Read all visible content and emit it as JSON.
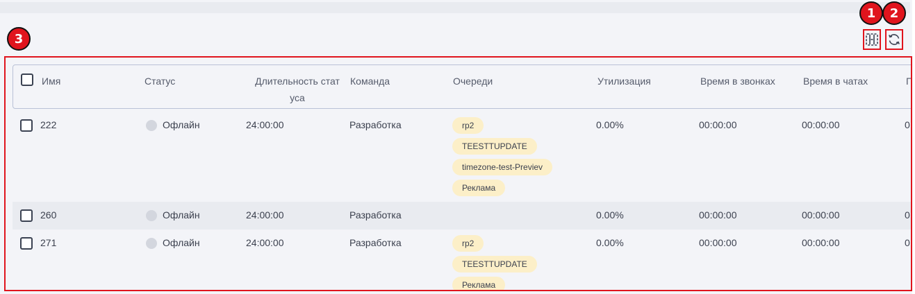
{
  "markers": [
    "1",
    "2",
    "3"
  ],
  "toolbar": {
    "columns_icon": "table-columns-icon",
    "refresh_icon": "refresh-icon"
  },
  "table": {
    "headers": {
      "name": "Имя",
      "status": "Статус",
      "duration_line1": "Длительность стат",
      "duration_line2": "уса",
      "team": "Команда",
      "queues": "Очереди",
      "utilization": "Утилизация",
      "call_time": "Время в звонках",
      "chat_time": "Время в чатах",
      "next_partial": "П"
    },
    "rows": [
      {
        "name": "222",
        "status": "Офлайн",
        "duration": "24:00:00",
        "team": "Разработка",
        "queues": [
          "rp2",
          "TEESTTUPDATE",
          "timezone-test-Previev",
          "Реклама"
        ],
        "utilization": "0.00%",
        "call_time": "00:00:00",
        "chat_time": "00:00:00",
        "next_partial": "0"
      },
      {
        "name": "260",
        "status": "Офлайн",
        "duration": "24:00:00",
        "team": "Разработка",
        "queues": [],
        "utilization": "0.00%",
        "call_time": "00:00:00",
        "chat_time": "00:00:00",
        "next_partial": "0"
      },
      {
        "name": "271",
        "status": "Офлайн",
        "duration": "24:00:00",
        "team": "Разработка",
        "queues": [
          "rp2",
          "TEESTTUPDATE",
          "Реклама"
        ],
        "utilization": "0.00%",
        "call_time": "00:00:00",
        "chat_time": "00:00:00",
        "next_partial": "0"
      }
    ]
  },
  "colors": {
    "annotation": "#e0141d",
    "chip_bg": "#fcefc8",
    "status_offline": "#d3d6de",
    "header_border": "#b9c1d6"
  }
}
